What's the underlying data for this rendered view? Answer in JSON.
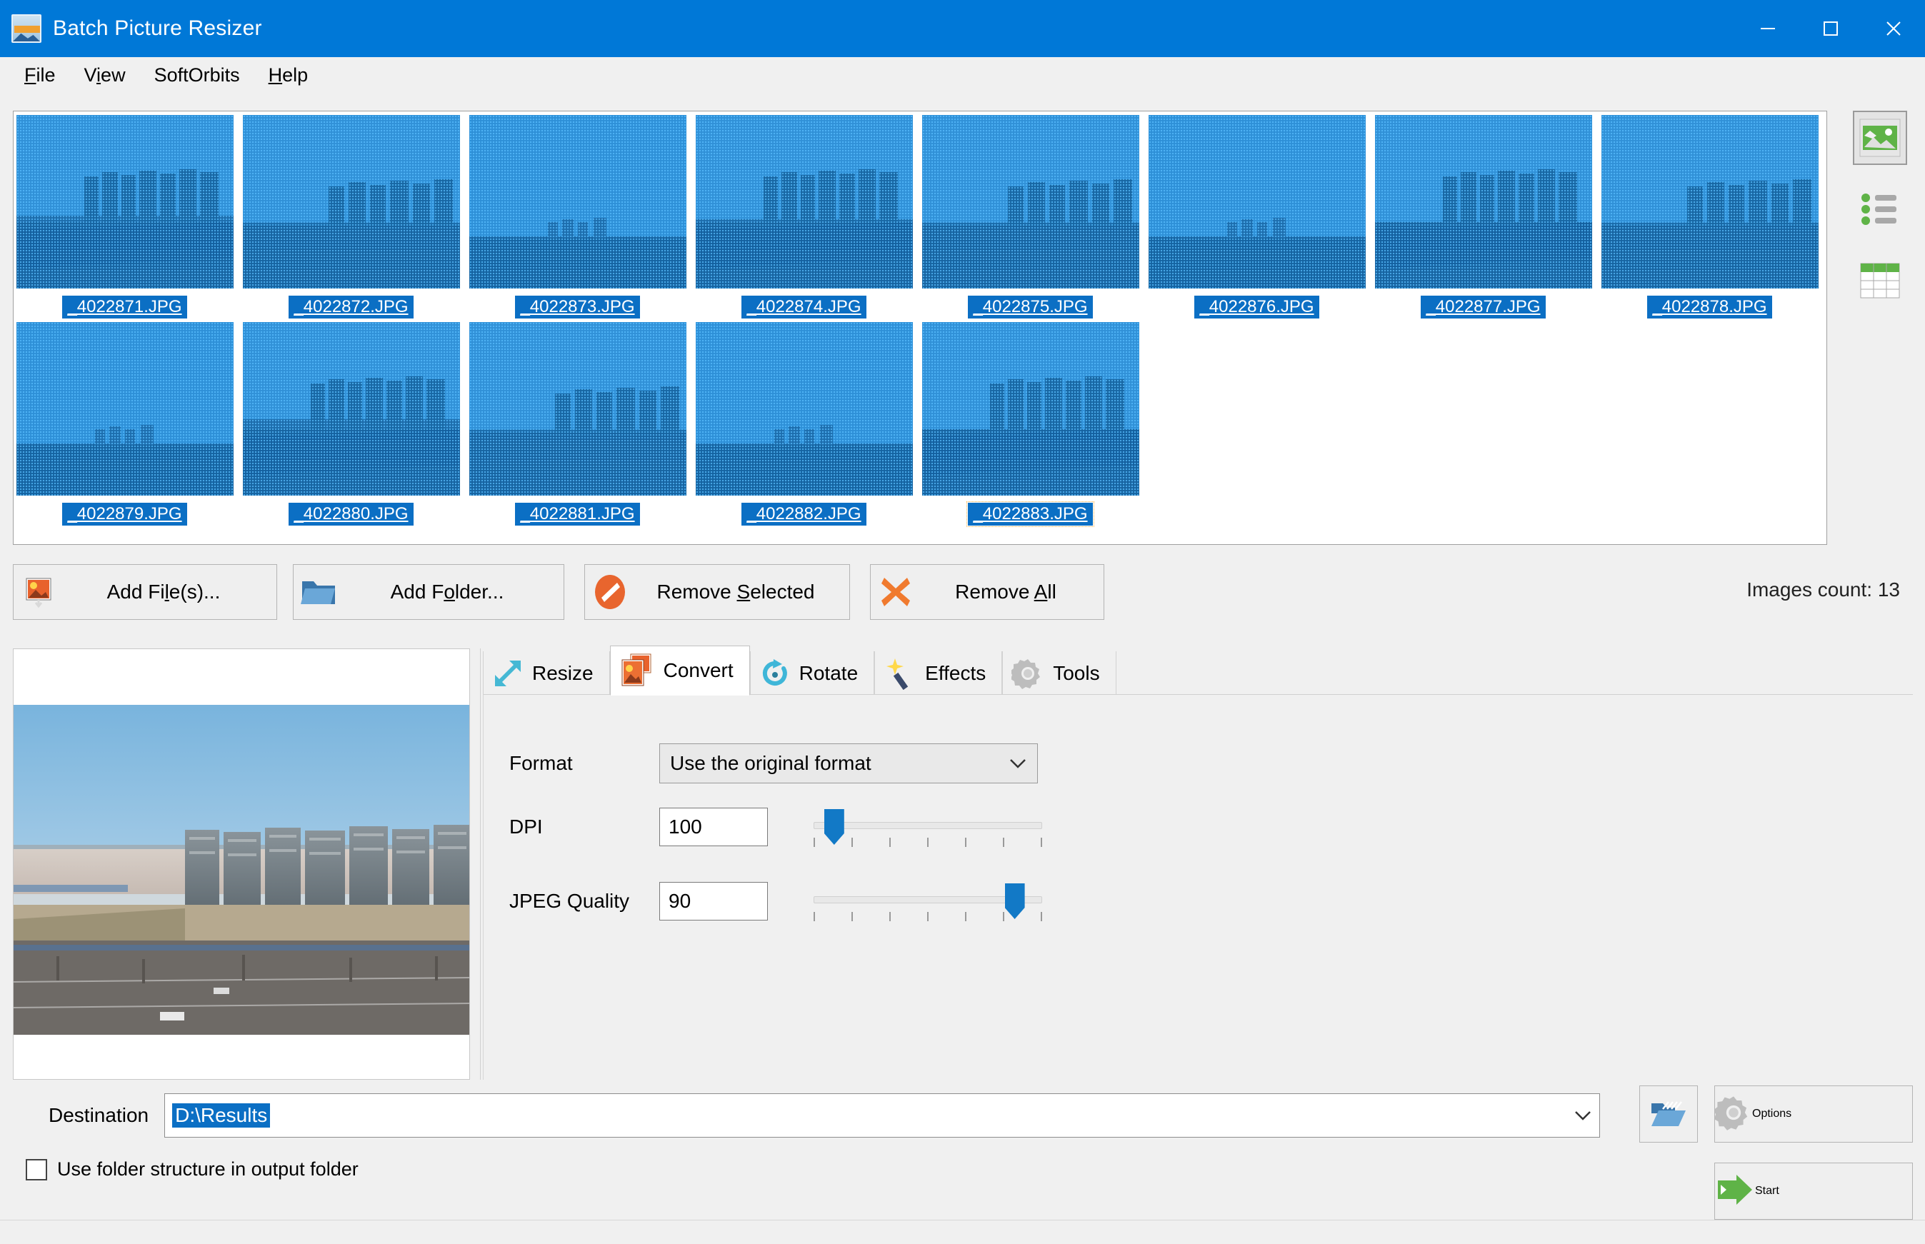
{
  "window": {
    "title": "Batch Picture Resizer",
    "app_icon": "picture-icon",
    "minimize": "minimize-icon",
    "maximize": "maximize-icon",
    "close": "close-icon"
  },
  "menu": [
    {
      "label": "File",
      "accel": "F"
    },
    {
      "label": "View",
      "accel": "V"
    },
    {
      "label": "SoftOrbits",
      "accel": ""
    },
    {
      "label": "Help",
      "accel": "H"
    }
  ],
  "thumbnails": {
    "row1": [
      {
        "name": "_4022871.JPG",
        "selected": true
      },
      {
        "name": "_4022872.JPG",
        "selected": true
      },
      {
        "name": "_4022873.JPG",
        "selected": true
      },
      {
        "name": "_4022874.JPG",
        "selected": true
      },
      {
        "name": "_4022875.JPG",
        "selected": true
      },
      {
        "name": "_4022876.JPG",
        "selected": true
      },
      {
        "name": "_4022877.JPG",
        "selected": true
      },
      {
        "name": "_4022878.JPG",
        "selected": true
      }
    ],
    "row2": [
      {
        "name": "_4022879.JPG",
        "selected": true
      },
      {
        "name": "_4022880.JPG",
        "selected": true
      },
      {
        "name": "_4022881.JPG",
        "selected": true
      },
      {
        "name": "_4022882.JPG",
        "selected": true
      },
      {
        "name": "_4022883.JPG",
        "selected": true,
        "focused": true
      }
    ]
  },
  "view_modes": [
    {
      "name": "thumbnail-view",
      "icon": "image-icon",
      "active": true
    },
    {
      "name": "list-view",
      "icon": "list-icon",
      "active": false
    },
    {
      "name": "details-view",
      "icon": "table-icon",
      "active": false
    }
  ],
  "toolbar": {
    "add_files": {
      "label_pre": "Add Fi",
      "accel": "l",
      "label_post": "e(s)...",
      "icon": "add-picture-icon"
    },
    "add_folder": {
      "label_pre": "Add F",
      "accel": "o",
      "label_post": "lder...",
      "icon": "folder-icon"
    },
    "remove_selected": {
      "label_pre": "Remove ",
      "accel": "S",
      "label_post": "elected",
      "icon": "no-entry-icon"
    },
    "remove_all": {
      "label_pre": "Remove ",
      "accel": "A",
      "label_post": "ll",
      "icon": "red-x-icon"
    },
    "images_count": "Images count: 13"
  },
  "tabs": [
    {
      "label": "Resize",
      "icon": "resize-arrow-icon",
      "active": false
    },
    {
      "label": "Convert",
      "icon": "convert-images-icon",
      "active": true
    },
    {
      "label": "Rotate",
      "icon": "rotate-icon",
      "active": false
    },
    {
      "label": "Effects",
      "icon": "magic-wand-icon",
      "active": false
    },
    {
      "label": "Tools",
      "icon": "gear-icon",
      "active": false
    }
  ],
  "convert_panel": {
    "format_label": "Format",
    "format_value": "Use the original format",
    "format_options": [
      "Use the original format"
    ],
    "dpi_label": "DPI",
    "dpi_value": "100",
    "dpi_slider_percent": 9,
    "jpeg_label": "JPEG Quality",
    "jpeg_value": "90",
    "jpeg_slider_percent": 88,
    "slider_tick_count": 7
  },
  "destination": {
    "label": "Destination",
    "value": "D:\\Results",
    "browse_icon": "open-folder-icon",
    "dropdown_icon": "chevron-down-icon"
  },
  "checkbox": {
    "label": "Use folder structure in output folder",
    "checked": false
  },
  "bottom_buttons": {
    "options": {
      "label": "Options",
      "icon": "gear-icon"
    },
    "start": {
      "label": "Start",
      "icon": "green-arrow-icon"
    }
  },
  "colors": {
    "titlebar": "#0078d7",
    "selection": "#0b6fc4",
    "accent_green": "#5fb347",
    "accent_orange": "#ef7d3a",
    "slider_blue": "#1279c6",
    "panel_bg": "#f0f0f0"
  }
}
